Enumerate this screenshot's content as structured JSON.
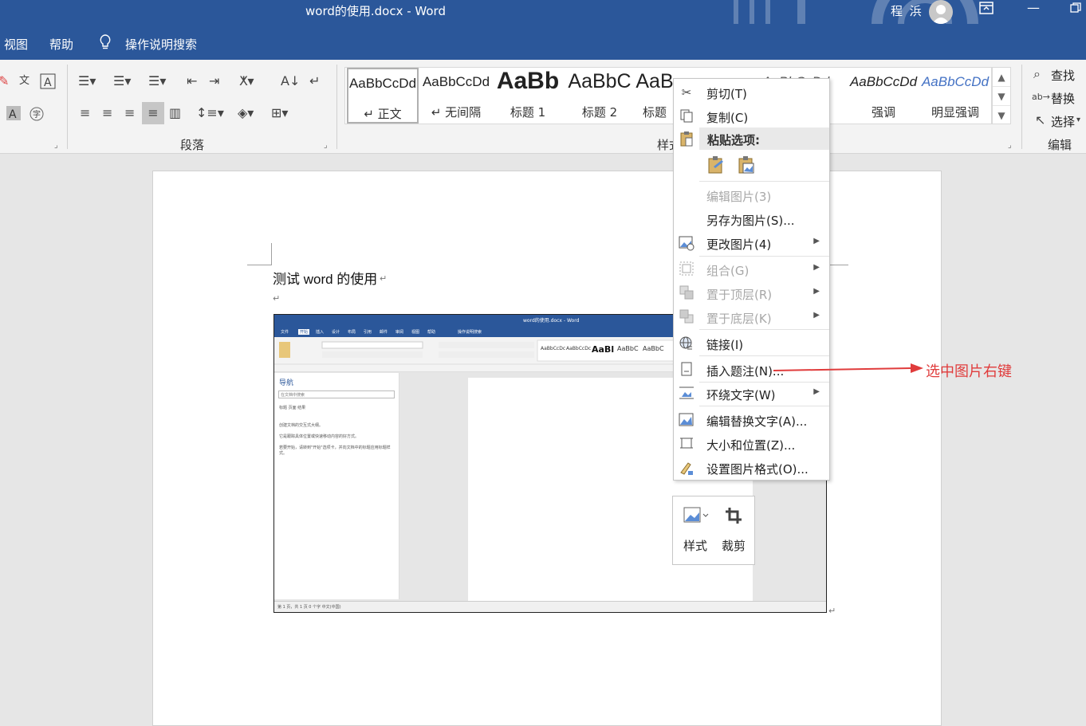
{
  "window": {
    "title": "word的使用.docx  -  Word",
    "user": "程 浜",
    "controls": [
      "ribbon-display",
      "minimize",
      "restore"
    ]
  },
  "menubar": {
    "items": [
      {
        "label": "视图"
      },
      {
        "label": "帮助"
      }
    ],
    "tell_me": "操作说明搜索"
  },
  "ribbon": {
    "groups": {
      "paragraph": "段落",
      "styles": "样式",
      "editing": "编辑"
    },
    "styles": [
      {
        "sample": "AaBbCcDd",
        "name": "↵ 正文"
      },
      {
        "sample": "AaBbCcDd",
        "name": "↵ 无间隔"
      },
      {
        "sample": "AaBb",
        "name": "标题 1"
      },
      {
        "sample": "AaBbC",
        "name": "标题 2"
      },
      {
        "sample": "AaB",
        "name": "标题"
      },
      {
        "sample": "AaBbCcDd",
        "name": "强调"
      },
      {
        "sample": "AaBbCcDd",
        "name": "强调"
      },
      {
        "sample": "AaBbCcDd",
        "name": "明显强调"
      }
    ],
    "editing": {
      "find": "查找",
      "replace": "替换",
      "select": "选择"
    }
  },
  "document": {
    "line1": "测试 word 的使用",
    "para_mark": "↵"
  },
  "embedded_image": {
    "title": "word的使用.docx - Word",
    "menu": [
      "文件",
      "开始",
      "插入",
      "设计",
      "布局",
      "引用",
      "邮件",
      "审阅",
      "视图",
      "帮助",
      "操作说明搜索"
    ],
    "nav_title": "导航",
    "nav_search": "在文档中搜索",
    "nav_tabs": "标题    页面    结果",
    "nav_lines": [
      "创建文档的交互式大纲。",
      "它是跟踪具体位置或快速移动内容的好方式。",
      "若要开始，请转到\"开始\"选项卡，并向文档中的标题应用标题样式。"
    ],
    "status": "第 1 页，共 1 页     0 个字     中文(中国)"
  },
  "context_menu": {
    "cut": "剪切(T)",
    "copy": "复制(C)",
    "paste_options": "粘贴选项:",
    "edit_picture": "编辑图片(3)",
    "save_as_picture": "另存为图片(S)...",
    "change_picture": "更改图片(4)",
    "group": "组合(G)",
    "bring_front": "置于顶层(R)",
    "send_back": "置于底层(K)",
    "link": "链接(I)",
    "insert_caption": "插入题注(N)...",
    "wrap_text": "环绕文字(W)",
    "edit_alt_text": "编辑替换文字(A)...",
    "size_position": "大小和位置(Z)...",
    "format_picture": "设置图片格式(O)..."
  },
  "mini_toolbar": {
    "style": "样式",
    "crop": "裁剪"
  },
  "annotation": {
    "text": "选中图片右键",
    "color": "#e03c3c"
  },
  "colors": {
    "word_blue": "#2b579a"
  }
}
